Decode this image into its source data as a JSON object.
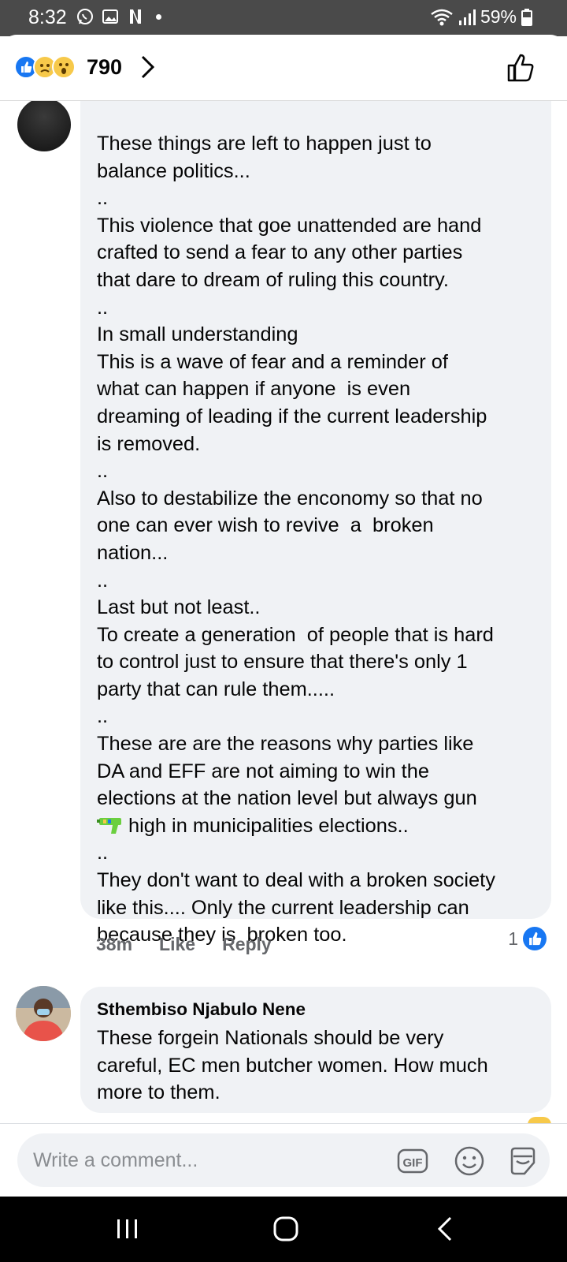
{
  "status_bar": {
    "time": "8:32",
    "battery": "59%",
    "icons": [
      "whatsapp-icon",
      "gallery-icon",
      "netflix-icon",
      "wifi-icon",
      "signal-icon",
      "battery-icon"
    ]
  },
  "reactions": {
    "types": [
      "like",
      "sad",
      "wow"
    ],
    "count": "790"
  },
  "comments": [
    {
      "text": "These things are left to happen just to\nbalance politics...\n..\nThis violence that goe unattended are hand\ncrafted to send a fear to any other parties\nthat dare to dream of ruling this country.\n..\nIn small understanding\nThis is a wave of fear and a reminder of\nwhat can happen if anyone  is even\ndreaming of leading if the current leadership\nis removed.\n..\nAlso to destabilize the enconomy so that no\none can ever wish to revive  a  broken\nnation...\n..\nLast but not least..\nTo create a generation  of people that is hard\nto control just to ensure that there's only 1\nparty that can rule them.....\n..\nThese are are the reasons why parties like\nDA and EFF are not aiming to win the\nelections at the nation level but always gun\n",
      "text_after_emoji": "high in municipalities elections..\n..\nThey don't want to deal with a broken society\nlike this.... Only the current leadership can\nbecause they is  broken too.",
      "emoji": "water-pistol-emoji",
      "time": "38m",
      "like_label": "Like",
      "reply_label": "Reply",
      "like_count": "1"
    },
    {
      "author": "Sthembiso Njabulo Nene",
      "text": "These forgein Nationals should be very\ncareful, EC men butcher women. How much\nmore to them."
    }
  ],
  "composer": {
    "placeholder": "Write a comment...",
    "gif_label": "GIF"
  },
  "colors": {
    "accent": "#1877f2",
    "bubble": "#f0f2f5",
    "secondary_text": "#65676b"
  }
}
